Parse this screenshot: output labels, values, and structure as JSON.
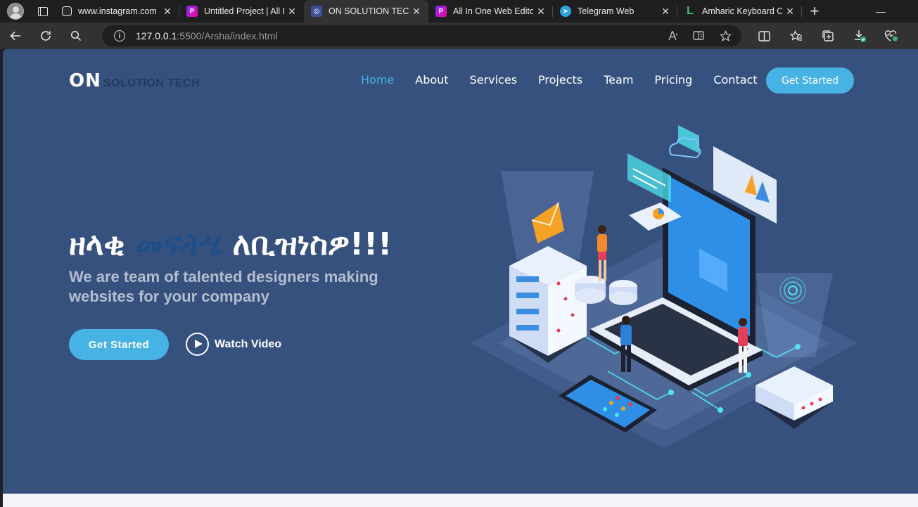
{
  "browser": {
    "tabs": [
      {
        "title": "www.instagram.com",
        "icon": "instagram-favicon",
        "active": false
      },
      {
        "title": "Untitled Project | All I",
        "icon": "project-favicon",
        "active": false
      },
      {
        "title": "ON SOLUTION TECH",
        "icon": "site-favicon",
        "active": true
      },
      {
        "title": "All In One Web Editor",
        "icon": "project-favicon",
        "active": false
      },
      {
        "title": "Telegram Web",
        "icon": "telegram-favicon",
        "active": false
      },
      {
        "title": "Amharic Keyboard O",
        "icon": "keyboard-favicon",
        "active": false
      }
    ],
    "close_glyph": "✕",
    "new_tab_glyph": "+",
    "minimize_glyph": "—",
    "url_host": "127.0.0.1",
    "url_path": ":5500/Arsha/index.html",
    "colors": {
      "chrome": "#1f1f1f",
      "toolbar": "#323232"
    }
  },
  "site": {
    "logo_main": "ON",
    "logo_sub": "SOLUTION TECH",
    "nav": [
      {
        "label": "Home",
        "active": true
      },
      {
        "label": "About",
        "active": false
      },
      {
        "label": "Services",
        "active": false
      },
      {
        "label": "Projects",
        "active": false
      },
      {
        "label": "Team",
        "active": false
      },
      {
        "label": "Pricing",
        "active": false
      },
      {
        "label": "Contact",
        "active": false
      }
    ],
    "nav_cta": "Get Started",
    "hero": {
      "title_part1": "ዘላቂ ",
      "title_accent": "መፍትሄ",
      "title_part2": " ለቢዝነስዎ!!!",
      "subtitle": "We are team of talented designers making websites for your company",
      "primary_button": "Get Started",
      "video_button": "Watch Video"
    },
    "colors": {
      "background": "#37517e",
      "accent": "#47b2e4",
      "title_accent": "#1d4e89"
    }
  }
}
